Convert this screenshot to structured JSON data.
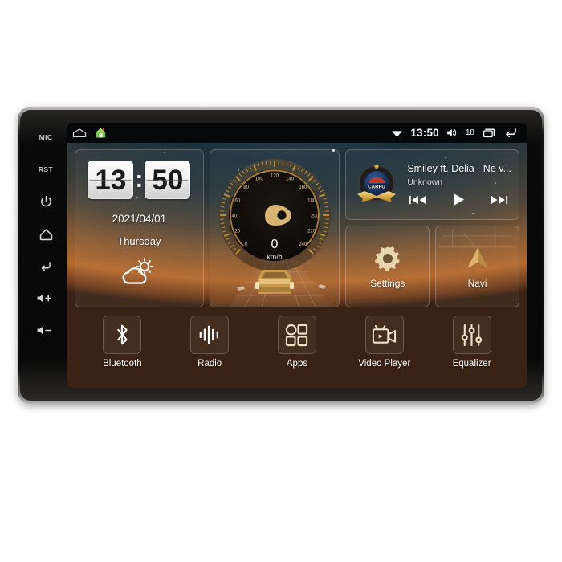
{
  "device": {
    "side_keys": [
      {
        "name": "mic",
        "label": "MIC",
        "icon": "mic-text"
      },
      {
        "name": "reset",
        "label": "RST",
        "icon": "reset-text"
      },
      {
        "name": "power",
        "label": "",
        "icon": "power-icon"
      },
      {
        "name": "home",
        "label": "",
        "icon": "home-icon"
      },
      {
        "name": "back",
        "label": "",
        "icon": "back-icon"
      },
      {
        "name": "volume-up",
        "label": "",
        "icon": "volume-up-icon"
      },
      {
        "name": "volume-down",
        "label": "",
        "icon": "volume-down-icon"
      }
    ]
  },
  "statusbar": {
    "left_icons": [
      "home-outline-icon",
      "green-house-icon"
    ],
    "wifi_icon": "wifi-icon",
    "clock": "13:50",
    "volume_icon": "volume-icon",
    "volume_value": "18",
    "recents_icon": "recents-icon",
    "back_icon": "back-icon"
  },
  "clock_widget": {
    "hours": "13",
    "minutes": "50",
    "separator": ":",
    "date": "2021/04/01",
    "weekday": "Thursday",
    "weather_icon": "partly-cloudy-icon"
  },
  "speed_widget": {
    "value": "0",
    "unit": "km/h",
    "ticks": [
      "0",
      "20",
      "40",
      "60",
      "80",
      "100",
      "120",
      "140",
      "160",
      "180",
      "200",
      "220",
      "240"
    ],
    "max": 240,
    "gauge_color": "#d9a441",
    "car_icon": "car-rear-icon"
  },
  "music_widget": {
    "album_art": "carfu-badge",
    "badge_text": "CARFU",
    "title": "Smiley ft. Delia - Ne v...",
    "artist": "Unknown",
    "controls": [
      {
        "name": "previous-track-button",
        "icon": "previous-icon"
      },
      {
        "name": "play-button",
        "icon": "play-icon"
      },
      {
        "name": "next-track-button",
        "icon": "next-icon"
      }
    ]
  },
  "tiles": [
    {
      "name": "settings",
      "label": "Settings",
      "icon": "gear-icon"
    },
    {
      "name": "navi",
      "label": "Navi",
      "icon": "navigation-arrow-icon"
    }
  ],
  "dock": [
    {
      "name": "bluetooth",
      "label": "Bluetooth",
      "icon": "bluetooth-icon"
    },
    {
      "name": "radio",
      "label": "Radio",
      "icon": "radio-waveform-icon"
    },
    {
      "name": "apps",
      "label": "Apps",
      "icon": "apps-grid-icon"
    },
    {
      "name": "video-player",
      "label": "Video Player",
      "icon": "video-camera-icon"
    },
    {
      "name": "equalizer",
      "label": "Equalizer",
      "icon": "equalizer-sliders-icon"
    }
  ],
  "colors": {
    "accent_gold": "#d9a441",
    "screen_top": "#243a47",
    "screen_bottom": "#b5692c",
    "status_bg": "#060709",
    "text": "#ffffff"
  }
}
